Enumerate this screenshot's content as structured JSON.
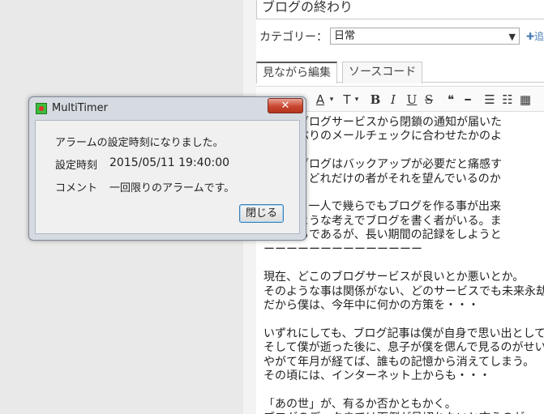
{
  "editor": {
    "title_value": "ブログの終わり",
    "category_label": "カテゴリー：",
    "category_value": "日常",
    "add_link": "✚追",
    "tabs": [
      {
        "label": "見ながら編集",
        "active": true
      },
      {
        "label": "ソースコード",
        "active": false
      }
    ],
    "toolbar": {
      "font_size": "A",
      "font_family": "T",
      "bold": "B",
      "italic": "I",
      "underline": "U",
      "strike": "S",
      "quote": "❝",
      "hr": "━",
      "ul": "☰",
      "ol": "☷",
      "table": "▦"
    },
    "content_lines": [
      "ここのブログサービスから閉鎖の通知が届いた",
      "、久しぶりのメールチェックに合わせたかのよ",
      "",
      "自分のブログはバックアップが必要だと痛感す",
      "一方で、どれだけの者がそれを望んでいるのか",
      "",
      "ころで、一人で幾らでもブログを作る事が出来",
      "り取るような考えでブログを書く者がいる。ま",
      "いろいろであるが、長い期間の記録をしようと",
      "ーーーーーーーーーーーーーー",
      "",
      "現在、どこのブログサービスが良いとか悪いとか。",
      "そのような事は関係がない、どのサービスでも未来永劫",
      "だから僕は、今年中に何かの方策を・・・",
      "",
      "いずれにしても、ブログ記事は僕が自身で思い出として",
      "そして僕が逝った後に、息子が僕を偲んで見るのがせい",
      "やがて年月が経てば、誰もの記憶から消えてしまう。",
      "その頃には、インターネット上からも・・・",
      "",
      "「あの世」が、有るか否かともかく。",
      "ブログのデータまでは面倒が見切れないと言うのが、"
    ]
  },
  "dialog": {
    "title": "MultiTimer",
    "close_glyph": "✕",
    "message": "アラームの設定時刻になりました。",
    "time_label": "設定時刻",
    "time_value": "2015/05/11  19:40:00",
    "comment_label": "コメント",
    "comment_value": "一回限りのアラームです。",
    "button_label": "閉じる"
  }
}
